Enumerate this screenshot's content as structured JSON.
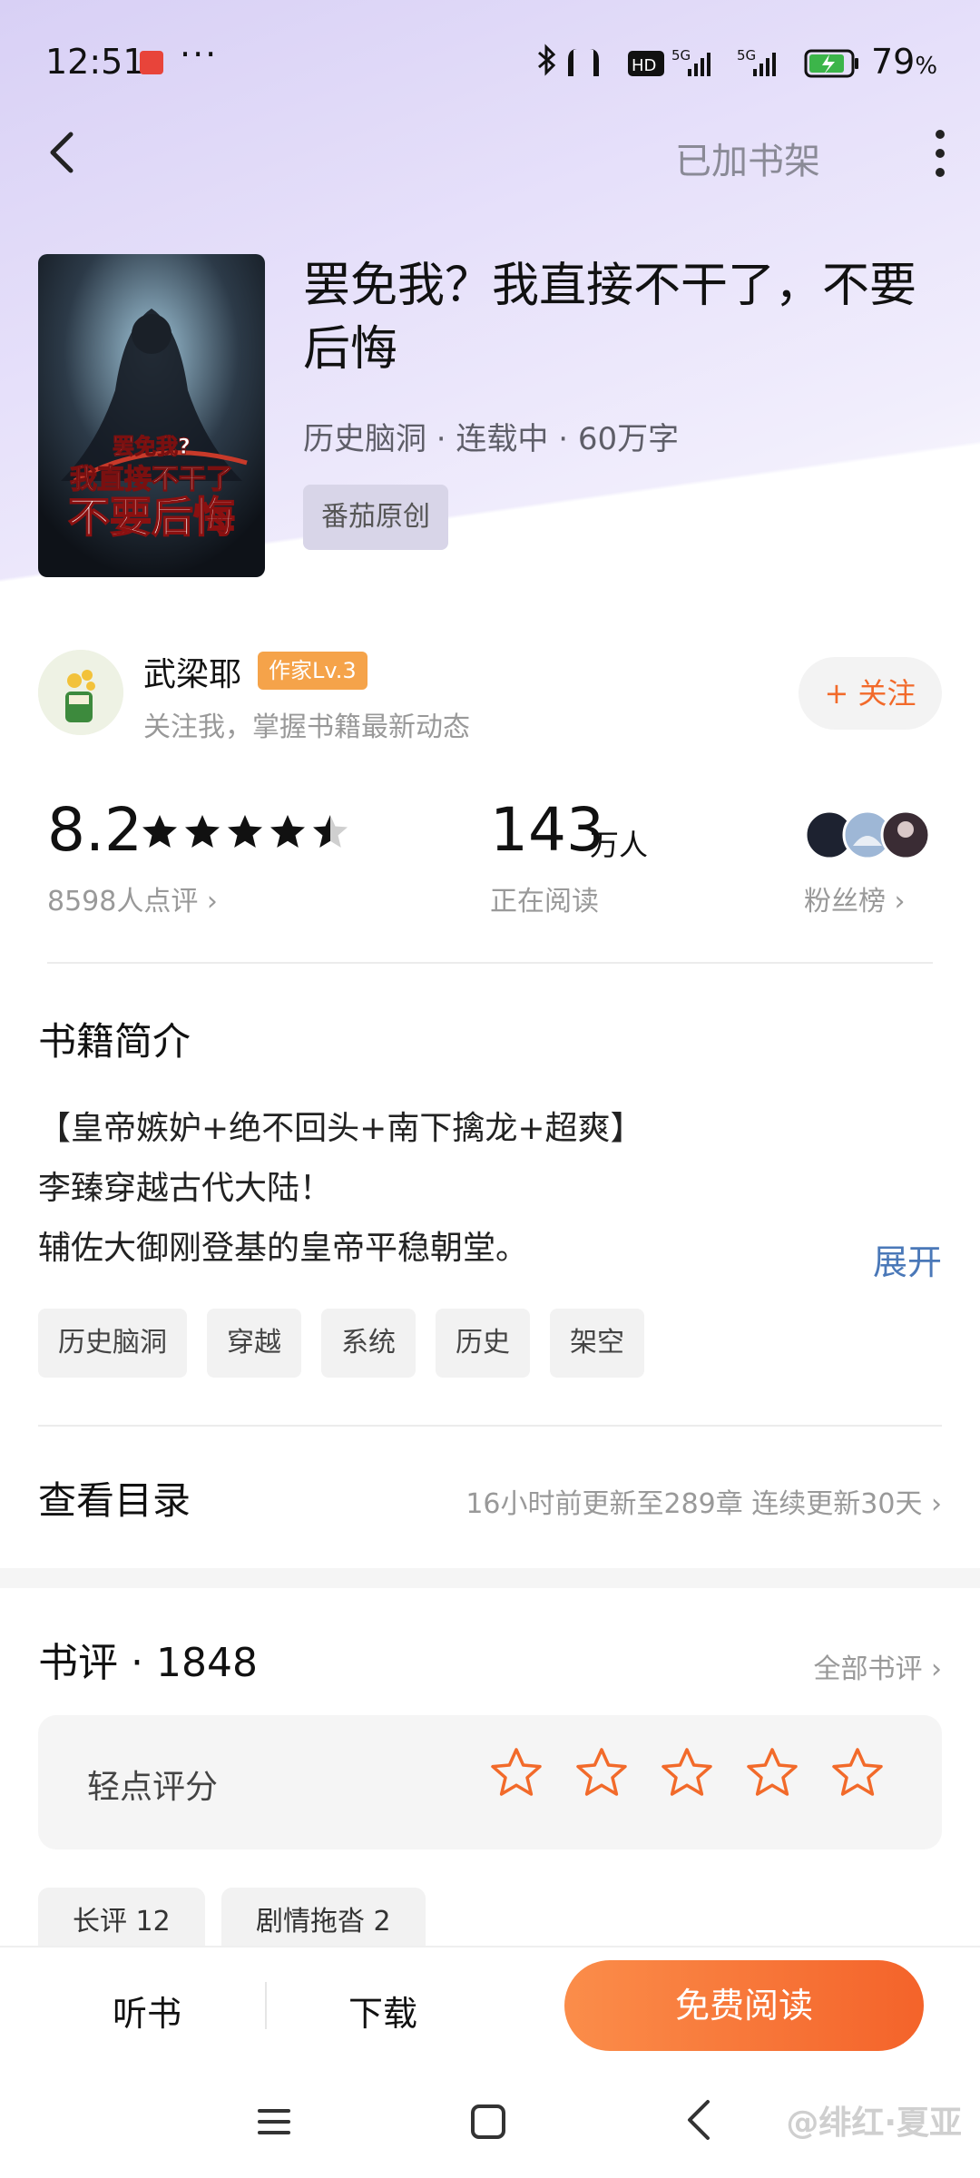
{
  "status_bar": {
    "time": "12:51",
    "battery": "79",
    "battery_unit": "%",
    "network_hd": "HD",
    "signal_1": "5G",
    "signal_2": "5G"
  },
  "nav": {
    "added_label": "已加书架"
  },
  "book": {
    "title": "罢免我？我直接不干了，不要后悔",
    "meta": "历史脑洞 · 连载中 · 60万字",
    "source_tag": "番茄原创",
    "cover_text_1": "罢免我?",
    "cover_text_2": "我直接不干了",
    "cover_text_3": "不要后悔"
  },
  "author": {
    "name": "武梁耶",
    "badge": "作家Lv.3",
    "subtitle": "关注我，掌握书籍最新动态",
    "follow_label": "+ 关注"
  },
  "stats": {
    "rating": "8.2",
    "rating_stars": 4.5,
    "rating_count": "8598人点评 ›",
    "readers": "143",
    "readers_unit": "万人",
    "readers_label": "正在阅读",
    "fans_label": "粉丝榜 ›"
  },
  "intro": {
    "title": "书籍简介",
    "lines": [
      "【皇帝嫉妒+绝不回头+南下擒龙+超爽】",
      "李臻穿越古代大陆！",
      "辅佐大御刚登基的皇帝平稳朝堂。"
    ],
    "expand_label": "展开",
    "tags": [
      "历史脑洞",
      "穿越",
      "系统",
      "历史",
      "架空"
    ]
  },
  "catalog": {
    "title": "查看目录",
    "info": "16小时前更新至289章 连续更新30天 ›"
  },
  "reviews": {
    "title": "书评 · 1848",
    "all_label": "全部书评 ›",
    "rate_label": "轻点评分",
    "chips": [
      "长评 12",
      "剧情拖沓 2"
    ]
  },
  "bottom_bar": {
    "listen_label": "听书",
    "download_label": "下载",
    "read_label": "免费阅读"
  },
  "watermark": "@绯红·夏亚",
  "colors": {
    "accent": "#f26a2a",
    "link": "#4a78b8",
    "badge": "#f5a34a",
    "header_tint": "#d8d0f5"
  }
}
